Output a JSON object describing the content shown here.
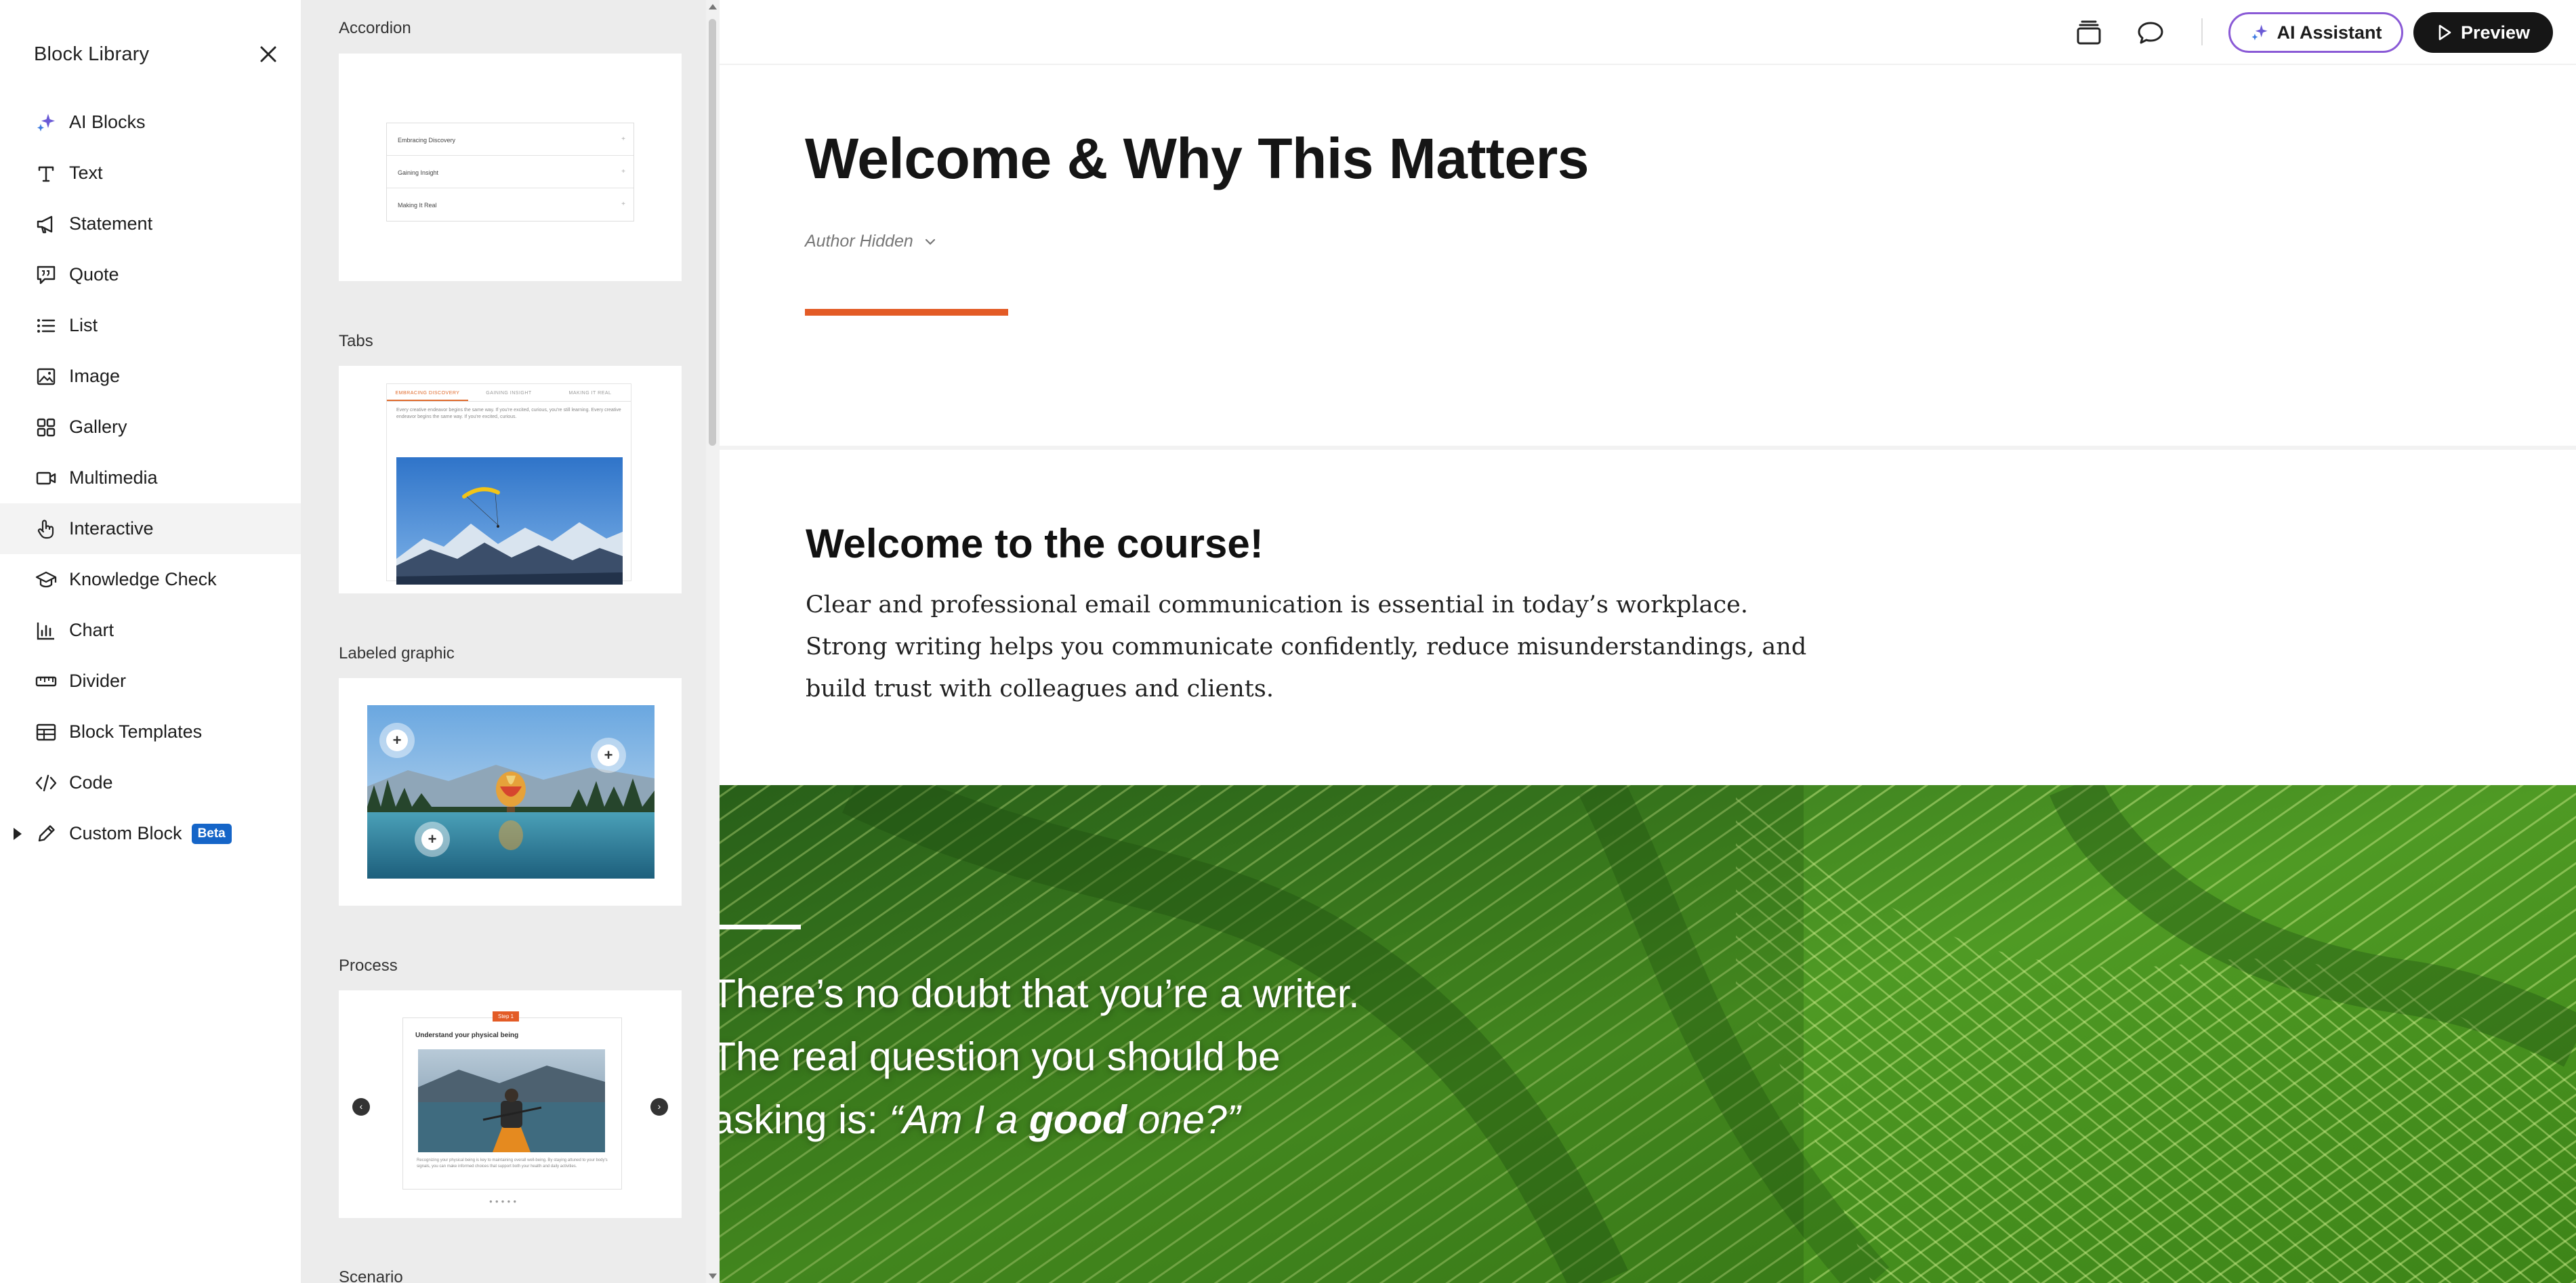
{
  "sidebar": {
    "title": "Block Library",
    "items": [
      {
        "label": "AI Blocks",
        "icon": "sparkle-icon"
      },
      {
        "label": "Text",
        "icon": "text-icon"
      },
      {
        "label": "Statement",
        "icon": "megaphone-icon"
      },
      {
        "label": "Quote",
        "icon": "quote-icon"
      },
      {
        "label": "List",
        "icon": "list-icon"
      },
      {
        "label": "Image",
        "icon": "image-icon"
      },
      {
        "label": "Gallery",
        "icon": "gallery-icon"
      },
      {
        "label": "Multimedia",
        "icon": "video-icon"
      },
      {
        "label": "Interactive",
        "icon": "pointer-hand-icon",
        "active": true
      },
      {
        "label": "Knowledge Check",
        "icon": "graduation-cap-icon"
      },
      {
        "label": "Chart",
        "icon": "chart-icon"
      },
      {
        "label": "Divider",
        "icon": "ruler-icon"
      },
      {
        "label": "Block Templates",
        "icon": "table-icon"
      },
      {
        "label": "Code",
        "icon": "code-icon"
      },
      {
        "label": "Custom Block",
        "icon": "pencil-icon",
        "badge": "Beta"
      }
    ]
  },
  "templates": {
    "accordion": {
      "label": "Accordion",
      "rows": [
        "Embracing Discovery",
        "Gaining Insight",
        "Making It Real"
      ]
    },
    "tabs": {
      "label": "Tabs",
      "tab_names": [
        "EMBRACING DISCOVERY",
        "GAINING INSIGHT",
        "MAKING IT REAL"
      ],
      "preview_text": "Every creative endeavor begins the same way. If you're excited, curious, you're still learning. Every creative endeavor begins the same way. If you're excited, curious."
    },
    "labeled_graphic": {
      "label": "Labeled graphic"
    },
    "process": {
      "label": "Process",
      "step": "Step 1",
      "title": "Understand your physical being",
      "text": "Recognizing your physical being is key to maintaining overall well-being. By staying attuned to your body's signals, you can make informed choices that support both your health and daily activities."
    },
    "scenario": {
      "label": "Scenario"
    }
  },
  "topbar": {
    "ai_label": "AI Assistant",
    "preview_label": "Preview"
  },
  "lesson": {
    "title": "Welcome & Why This Matters",
    "author": "Author Hidden",
    "accent_color": "#e35b26"
  },
  "text_block": {
    "heading": "Welcome to the course!",
    "body": "Clear and professional email communication is essential in today’s workplace. Strong writing helps you communicate confidently, reduce misunderstandings, and build trust with colleagues and clients."
  },
  "banner": {
    "line1": "There’s no doubt that you’re a writer.",
    "line2": "The real question you should be",
    "line3_pre": "asking is: ",
    "line3_q1": "“Am I a ",
    "line3_bold": "good",
    "line3_q2": " one?”"
  }
}
